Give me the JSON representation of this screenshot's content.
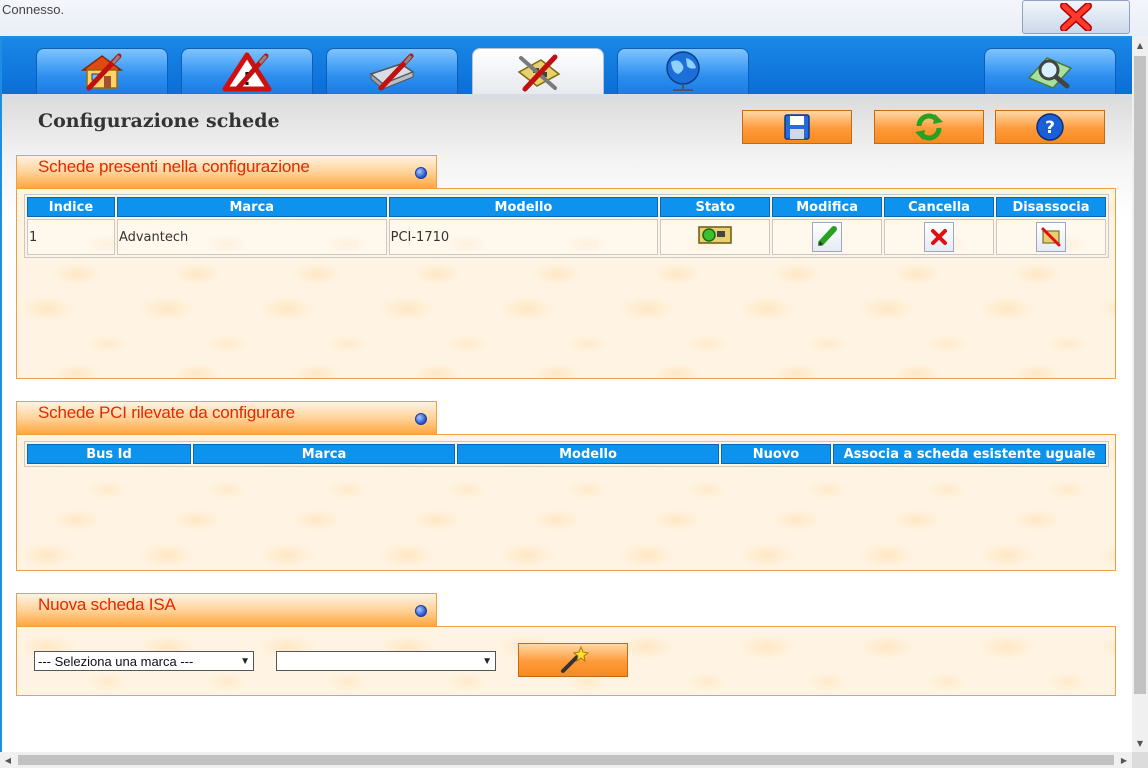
{
  "status": {
    "text": "Connesso."
  },
  "colors": {
    "accent_blue": "#0d93ee",
    "orange": "#ff9a3a",
    "panel_title": "#e02a00"
  },
  "tabs": [
    {
      "icon": "home-settings-icon",
      "active": false
    },
    {
      "icon": "warning-settings-icon",
      "active": false
    },
    {
      "icon": "drive-settings-icon",
      "active": false
    },
    {
      "icon": "board-tools-icon",
      "active": true
    },
    {
      "icon": "network-globe-icon",
      "active": false
    },
    {
      "icon": "map-search-icon",
      "active": false
    }
  ],
  "page": {
    "title": "Configurazione schede"
  },
  "toolbar": {
    "save_icon": "floppy-disk-icon",
    "refresh_icon": "refresh-arrows-icon",
    "help_label": "?"
  },
  "panel1": {
    "title": "Schede presenti nella configurazione",
    "columns": [
      "Indice",
      "Marca",
      "Modello",
      "Stato",
      "Modifica",
      "Cancella",
      "Disassocia"
    ],
    "rows": [
      {
        "indice": "1",
        "marca": "Advantech",
        "modello": "PCI-1710"
      }
    ]
  },
  "panel2": {
    "title": "Schede PCI rilevate da configurare",
    "columns": [
      "Bus Id",
      "Marca",
      "Modello",
      "Nuovo",
      "Associa a scheda esistente uguale"
    ],
    "rows": []
  },
  "panel3": {
    "title": "Nuova scheda ISA",
    "brand_select": "--- Seleziona una marca ---",
    "model_select": "",
    "wizard_icon": "magic-wand-icon"
  }
}
